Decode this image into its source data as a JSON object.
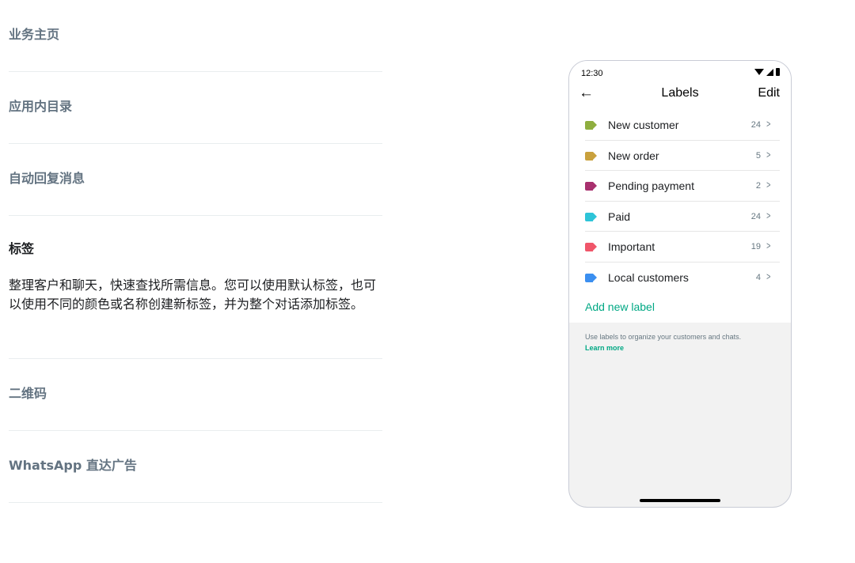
{
  "accordion": [
    {
      "title": "业务主页"
    },
    {
      "title": "应用内目录"
    },
    {
      "title": "自动回复消息"
    },
    {
      "title": "标签",
      "body": "整理客户和聊天，快速查找所需信息。您可以使用默认标签，也可以使用不同的颜色或名称创建新标签，并为整个对话添加标签。"
    },
    {
      "title": "二维码"
    },
    {
      "title": "WhatsApp 直达广告"
    }
  ],
  "phone": {
    "time": "12:30",
    "title": "Labels",
    "edit": "Edit",
    "back_icon": "arrow-left-icon",
    "labels": [
      {
        "name": "New customer",
        "count": "24",
        "color": "#8fae3f"
      },
      {
        "name": "New order",
        "count": "5",
        "color": "#c9a13d"
      },
      {
        "name": "Pending payment",
        "count": "2",
        "color": "#a8306e"
      },
      {
        "name": "Paid",
        "count": "24",
        "color": "#2ec4d8"
      },
      {
        "name": "Important",
        "count": "19",
        "color": "#f0566a"
      },
      {
        "name": "Local customers",
        "count": "4",
        "color": "#3b8ff0"
      }
    ],
    "add_label": "Add new label",
    "hint": "Use labels to organize your customers and chats.",
    "learn_more": "Learn more"
  }
}
